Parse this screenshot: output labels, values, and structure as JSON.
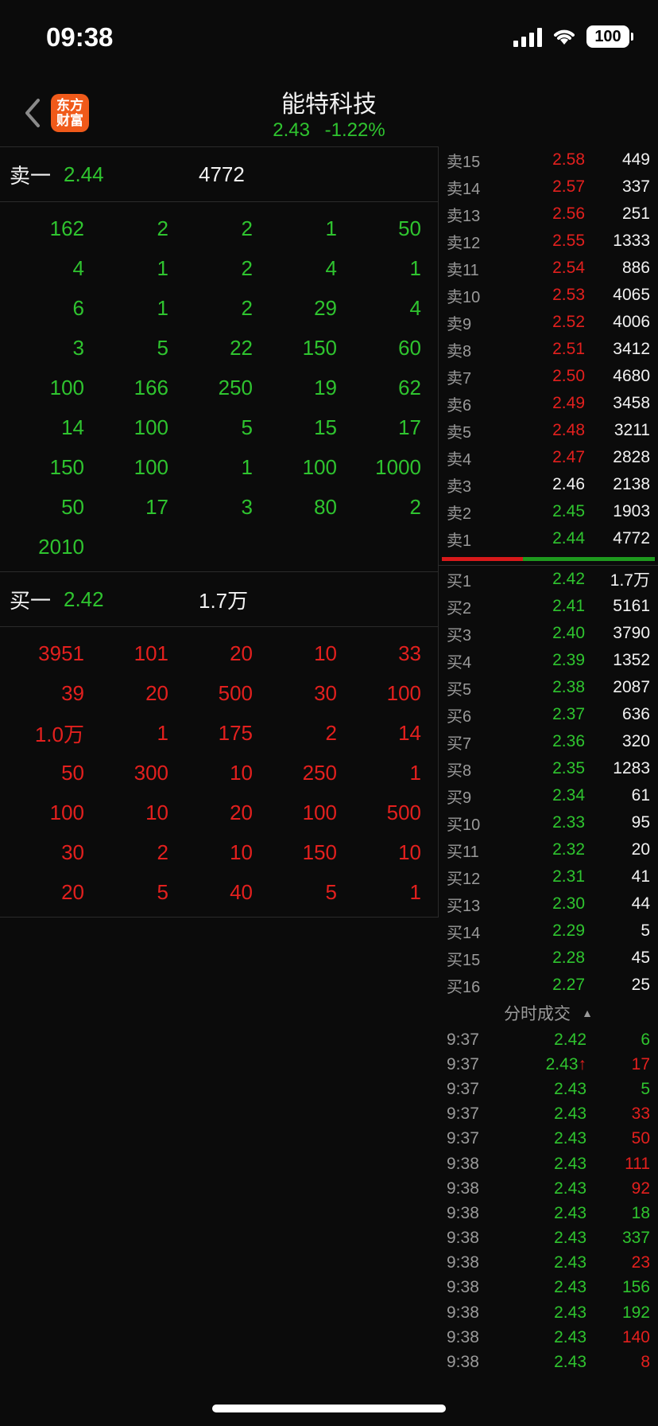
{
  "status": {
    "time": "09:38",
    "battery": "100"
  },
  "header": {
    "logo_line1": "东方",
    "logo_line2": "财富",
    "title": "能特科技",
    "price": "2.43",
    "change_pct": "-1.22%"
  },
  "left": {
    "ask1": {
      "label": "卖一",
      "price": "2.44",
      "volume": "4772"
    },
    "ask_orders": [
      [
        "162",
        "2",
        "2",
        "1",
        "50"
      ],
      [
        "4",
        "1",
        "2",
        "4",
        "1"
      ],
      [
        "6",
        "1",
        "2",
        "29",
        "4"
      ],
      [
        "3",
        "5",
        "22",
        "150",
        "60"
      ],
      [
        "100",
        "166",
        "250",
        "19",
        "62"
      ],
      [
        "14",
        "100",
        "5",
        "15",
        "17"
      ],
      [
        "150",
        "100",
        "1",
        "100",
        "1000"
      ],
      [
        "50",
        "17",
        "3",
        "80",
        "2"
      ],
      [
        "2010",
        "",
        "",
        "",
        ""
      ]
    ],
    "bid1": {
      "label": "买一",
      "price": "2.42",
      "volume": "1.7万"
    },
    "bid_orders": [
      [
        "3951",
        "101",
        "20",
        "10",
        "33"
      ],
      [
        "39",
        "20",
        "500",
        "30",
        "100"
      ],
      [
        "1.0万",
        "1",
        "175",
        "2",
        "14"
      ],
      [
        "50",
        "300",
        "10",
        "250",
        "1"
      ],
      [
        "100",
        "10",
        "20",
        "100",
        "500"
      ],
      [
        "30",
        "2",
        "10",
        "150",
        "10"
      ],
      [
        "20",
        "5",
        "40",
        "5",
        "1"
      ]
    ]
  },
  "orderbook": {
    "asks": [
      {
        "level": "卖15",
        "price": "2.58",
        "vol": "449",
        "color": "red"
      },
      {
        "level": "卖14",
        "price": "2.57",
        "vol": "337",
        "color": "red"
      },
      {
        "level": "卖13",
        "price": "2.56",
        "vol": "251",
        "color": "red"
      },
      {
        "level": "卖12",
        "price": "2.55",
        "vol": "1333",
        "color": "red"
      },
      {
        "level": "卖11",
        "price": "2.54",
        "vol": "886",
        "color": "red"
      },
      {
        "level": "卖10",
        "price": "2.53",
        "vol": "4065",
        "color": "red"
      },
      {
        "level": "卖9",
        "price": "2.52",
        "vol": "4006",
        "color": "red"
      },
      {
        "level": "卖8",
        "price": "2.51",
        "vol": "3412",
        "color": "red"
      },
      {
        "level": "卖7",
        "price": "2.50",
        "vol": "4680",
        "color": "red"
      },
      {
        "level": "卖6",
        "price": "2.49",
        "vol": "3458",
        "color": "red"
      },
      {
        "level": "卖5",
        "price": "2.48",
        "vol": "3211",
        "color": "red"
      },
      {
        "level": "卖4",
        "price": "2.47",
        "vol": "2828",
        "color": "red"
      },
      {
        "level": "卖3",
        "price": "2.46",
        "vol": "2138",
        "color": "white"
      },
      {
        "level": "卖2",
        "price": "2.45",
        "vol": "1903",
        "color": "green"
      },
      {
        "level": "卖1",
        "price": "2.44",
        "vol": "4772",
        "color": "green"
      }
    ],
    "bids": [
      {
        "level": "买1",
        "price": "2.42",
        "vol": "1.7万",
        "color": "green"
      },
      {
        "level": "买2",
        "price": "2.41",
        "vol": "5161",
        "color": "green"
      },
      {
        "level": "买3",
        "price": "2.40",
        "vol": "3790",
        "color": "green"
      },
      {
        "level": "买4",
        "price": "2.39",
        "vol": "1352",
        "color": "green"
      },
      {
        "level": "买5",
        "price": "2.38",
        "vol": "2087",
        "color": "green"
      },
      {
        "level": "买6",
        "price": "2.37",
        "vol": "636",
        "color": "green"
      },
      {
        "level": "买7",
        "price": "2.36",
        "vol": "320",
        "color": "green"
      },
      {
        "level": "买8",
        "price": "2.35",
        "vol": "1283",
        "color": "green"
      },
      {
        "level": "买9",
        "price": "2.34",
        "vol": "61",
        "color": "green"
      },
      {
        "level": "买10",
        "price": "2.33",
        "vol": "95",
        "color": "green"
      },
      {
        "level": "买11",
        "price": "2.32",
        "vol": "20",
        "color": "green"
      },
      {
        "level": "买12",
        "price": "2.31",
        "vol": "41",
        "color": "green"
      },
      {
        "level": "买13",
        "price": "2.30",
        "vol": "44",
        "color": "green"
      },
      {
        "level": "买14",
        "price": "2.29",
        "vol": "5",
        "color": "green"
      },
      {
        "level": "买15",
        "price": "2.28",
        "vol": "45",
        "color": "green"
      },
      {
        "level": "买16",
        "price": "2.27",
        "vol": "25",
        "color": "green"
      }
    ],
    "ratio": {
      "ask_fraction": 0.38,
      "bid_fraction": 0.62
    },
    "ticks_title": "分时成交",
    "ticks": [
      {
        "time": "9:37",
        "price": "2.42",
        "vol": "6",
        "vol_color": "green"
      },
      {
        "time": "9:37",
        "price": "2.43↑",
        "vol": "17",
        "vol_color": "red"
      },
      {
        "time": "9:37",
        "price": "2.43",
        "vol": "5",
        "vol_color": "green"
      },
      {
        "time": "9:37",
        "price": "2.43",
        "vol": "33",
        "vol_color": "red"
      },
      {
        "time": "9:37",
        "price": "2.43",
        "vol": "50",
        "vol_color": "red"
      },
      {
        "time": "9:38",
        "price": "2.43",
        "vol": "111",
        "vol_color": "red"
      },
      {
        "time": "9:38",
        "price": "2.43",
        "vol": "92",
        "vol_color": "red"
      },
      {
        "time": "9:38",
        "price": "2.43",
        "vol": "18",
        "vol_color": "green"
      },
      {
        "time": "9:38",
        "price": "2.43",
        "vol": "337",
        "vol_color": "green"
      },
      {
        "time": "9:38",
        "price": "2.43",
        "vol": "23",
        "vol_color": "red"
      },
      {
        "time": "9:38",
        "price": "2.43",
        "vol": "156",
        "vol_color": "green"
      },
      {
        "time": "9:38",
        "price": "2.43",
        "vol": "192",
        "vol_color": "green"
      },
      {
        "time": "9:38",
        "price": "2.43",
        "vol": "140",
        "vol_color": "red"
      },
      {
        "time": "9:38",
        "price": "2.43",
        "vol": "8",
        "vol_color": "red"
      }
    ]
  }
}
